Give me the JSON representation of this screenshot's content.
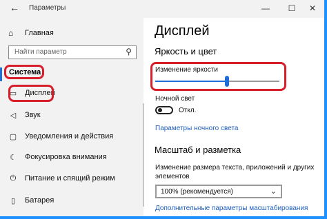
{
  "window": {
    "title": "Параметры",
    "back_icon": "back-arrow-icon"
  },
  "sidebar": {
    "home_label": "Главная",
    "search_placeholder": "Найти параметр",
    "section_title": "Система",
    "items": [
      {
        "label": "Дисплей",
        "icon": "monitor-icon",
        "selected": true
      },
      {
        "label": "Звук",
        "icon": "speaker-icon"
      },
      {
        "label": "Уведомления и действия",
        "icon": "notifications-icon"
      },
      {
        "label": "Фокусировка внимания",
        "icon": "moon-icon"
      },
      {
        "label": "Питание и спящий режим",
        "icon": "power-icon"
      },
      {
        "label": "Батарея",
        "icon": "battery-icon"
      }
    ]
  },
  "main": {
    "title": "Дисплей",
    "brightness_section": "Яркость и цвет",
    "brightness_label": "Изменение яркости",
    "brightness_value": 0.58,
    "night_light_label": "Ночной свет",
    "night_light_state": "Откл.",
    "night_light_link": "Параметры ночного света",
    "scale_section": "Масштаб и разметка",
    "scale_label_line1": "Изменение размера текста, приложений и других",
    "scale_label_line2": "элементов",
    "scale_value": "100% (рекомендуется)",
    "advanced_link": "Дополнительные параметры масштабирования"
  },
  "colors": {
    "accent": "#1e6fd9",
    "highlight": "#d81e2b",
    "link": "#1e5fbf"
  }
}
